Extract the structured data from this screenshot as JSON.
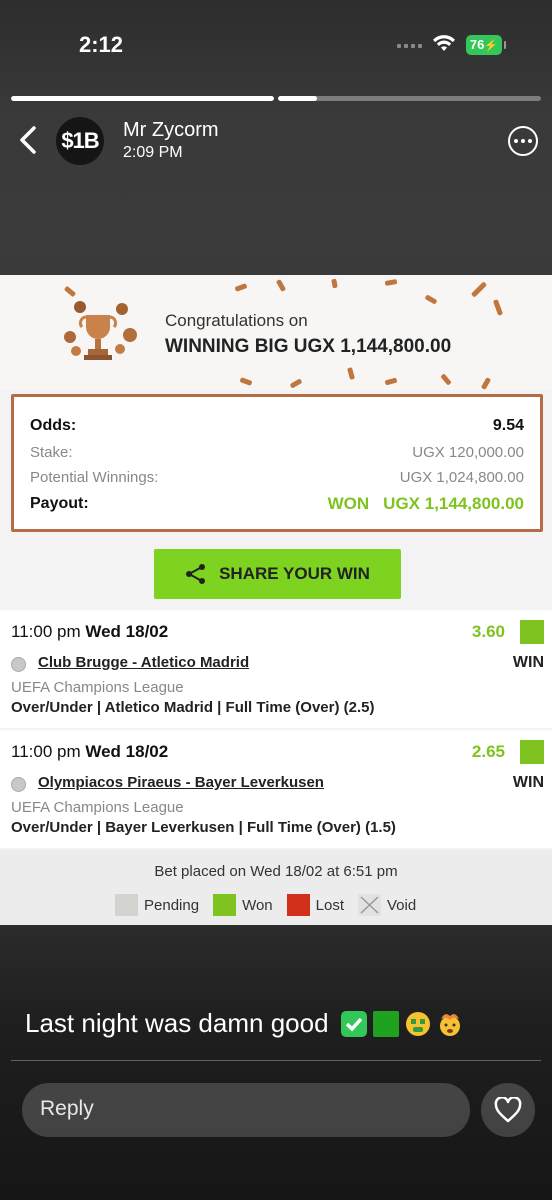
{
  "status_bar": {
    "time": "2:12",
    "battery": "76"
  },
  "story": {
    "progress": [
      1.0,
      0.15
    ],
    "avatar_text": "$1B",
    "user_name": "Mr Zycorm",
    "post_time": "2:09 PM"
  },
  "slip": {
    "congrats_line1": "Congratulations on",
    "congrats_line2": "WINNING BIG UGX 1,144,800.00",
    "summary": {
      "odds_label": "Odds:",
      "odds_value": "9.54",
      "stake_label": "Stake:",
      "stake_value": "UGX 120,000.00",
      "potential_label": "Potential Winnings:",
      "potential_value": "UGX 1,024,800.00",
      "payout_label": "Payout:",
      "payout_status": "WON",
      "payout_value": "UGX 1,144,800.00"
    },
    "share_label": "SHARE YOUR WIN",
    "bets": [
      {
        "time": "11:00 pm",
        "date": "Wed 18/02",
        "odds": "3.60",
        "match": "Club Brugge - Atletico Madrid",
        "result": "WIN",
        "league": "UEFA Champions League",
        "market": "Over/Under | Atletico Madrid | Full Time (Over) (2.5)"
      },
      {
        "time": "11:00 pm",
        "date": "Wed 18/02",
        "odds": "2.65",
        "match": "Olympiacos Piraeus - Bayer Leverkusen",
        "result": "WIN",
        "league": "UEFA Champions League",
        "market": "Over/Under | Bayer Leverkusen | Full Time (Over) (1.5)"
      }
    ],
    "placed": "Bet placed on Wed 18/02 at 6:51 pm",
    "legend": [
      {
        "label": "Pending",
        "color": "#d3d3cf"
      },
      {
        "label": "Won",
        "color": "#7ec320"
      },
      {
        "label": "Lost",
        "color": "#d0301a"
      },
      {
        "label": "Void",
        "color": "#e2e2e2"
      }
    ]
  },
  "caption": {
    "text": "Last night was damn good"
  },
  "reply": {
    "placeholder": "Reply"
  },
  "colors": {
    "accent_green": "#7ed321",
    "won_green": "#7ec320",
    "border_copper": "#b86c46"
  }
}
